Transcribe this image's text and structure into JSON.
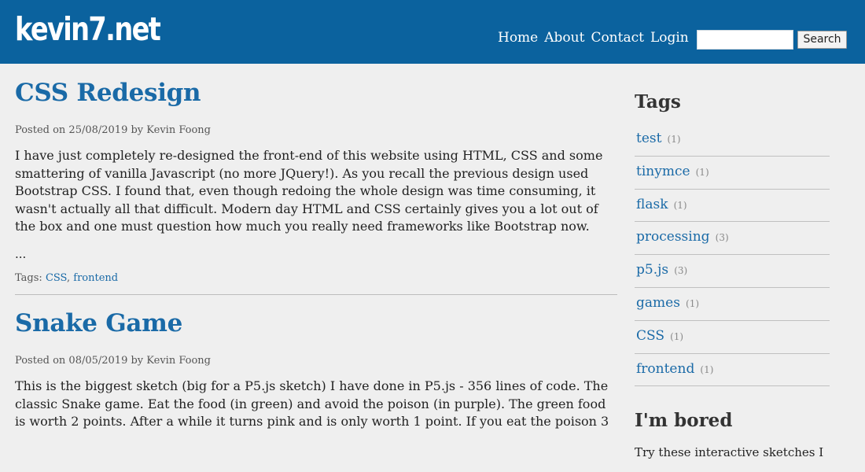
{
  "header": {
    "logo": "kevin7.net",
    "nav": [
      "Home",
      "About",
      "Contact",
      "Login"
    ],
    "search": {
      "value": "",
      "placeholder": "",
      "button": "Search"
    }
  },
  "posts": [
    {
      "title": "CSS Redesign",
      "meta": "Posted on 25/08/2019 by Kevin Foong",
      "body": "I have just completely re-designed the front-end of this website using HTML, CSS and some smattering of vanilla Javascript (no more JQuery!). As you recall the previous design used Bootstrap CSS. I found that, even though redoing the whole design was time consuming, it wasn't actually all that difficult. Modern day HTML and CSS certainly gives you a lot out of the box and one must question how much you really need frameworks like Bootstrap now.",
      "ellipsis": "...",
      "tags_label": "Tags:",
      "tags": [
        "CSS",
        "frontend"
      ]
    },
    {
      "title": "Snake Game",
      "meta": "Posted on 08/05/2019 by Kevin Foong",
      "body": "This is the biggest sketch (big for a P5.js sketch) I have done in P5.js - 356 lines of code. The classic Snake game. Eat the food (in green) and avoid the poison (in purple).  The green food is worth 2 points. After a while it turns pink and is only worth 1 point. If you eat the poison 3"
    }
  ],
  "sidebar": {
    "tags_heading": "Tags",
    "tags": [
      {
        "name": "test",
        "count": "(1)"
      },
      {
        "name": "tinymce",
        "count": "(1)"
      },
      {
        "name": "flask",
        "count": "(1)"
      },
      {
        "name": "processing",
        "count": "(3)"
      },
      {
        "name": "p5.js",
        "count": "(3)"
      },
      {
        "name": "games",
        "count": "(1)"
      },
      {
        "name": "CSS",
        "count": "(1)"
      },
      {
        "name": "frontend",
        "count": "(1)"
      }
    ],
    "bored_heading": "I'm bored",
    "bored_text": "Try these interactive sketches I"
  },
  "colors": {
    "header": "#0b629e",
    "link": "#1a6aa7",
    "background": "#efefef"
  }
}
